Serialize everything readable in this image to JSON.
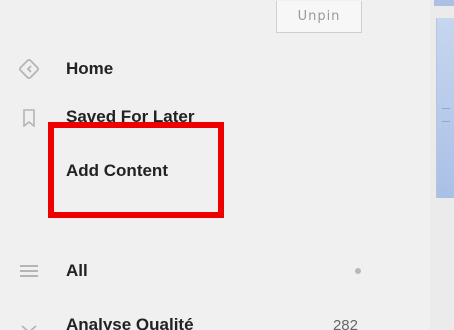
{
  "unpin": {
    "label": "Unpin"
  },
  "nav": {
    "home": {
      "label": "Home",
      "icon": "home-icon"
    },
    "saved": {
      "label": "Saved For Later",
      "icon": "bookmark-icon"
    },
    "add": {
      "label": "Add Content"
    },
    "all": {
      "label": "All",
      "icon": "list-icon"
    },
    "analyse": {
      "label": "Analyse Qualité",
      "count": "282",
      "icon": "chevron-down-icon"
    }
  },
  "colors": {
    "highlight": "#ee0000",
    "sidebar_bg": "#f0f0f0",
    "accent_panel": "#a9c0e6"
  }
}
